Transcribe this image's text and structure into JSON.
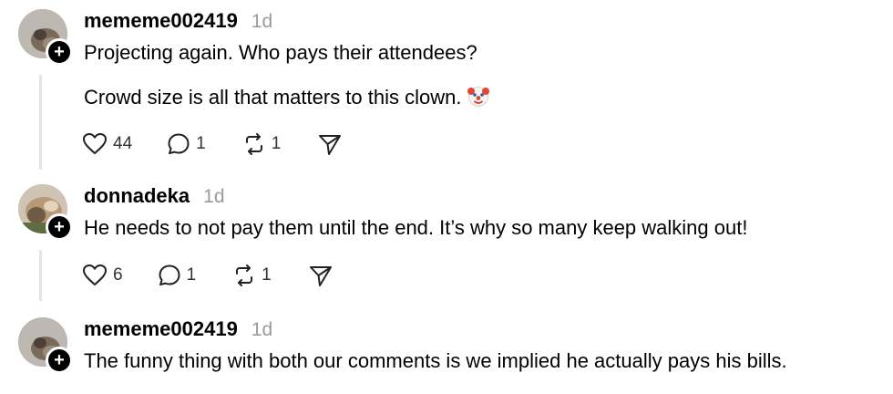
{
  "comments": [
    {
      "username": "mememe002419",
      "time": "1d",
      "lines": [
        "Projecting again. Who pays their attendees?",
        "Crowd size is all that matters to this clown."
      ],
      "emoji": "clown-face",
      "likes": "44",
      "replies": "1",
      "reposts": "1"
    },
    {
      "username": "donnadeka",
      "time": "1d",
      "lines": [
        "He needs to not pay them until the end. It’s why so many keep walking out!"
      ],
      "likes": "6",
      "replies": "1",
      "reposts": "1"
    },
    {
      "username": "mememe002419",
      "time": "1d",
      "lines": [
        "The funny thing with both our comments is we implied he actually pays his bills."
      ]
    }
  ],
  "icons": {
    "like": "heart-icon",
    "reply": "comment-bubble-icon",
    "repost": "repost-icon",
    "share": "send-icon",
    "follow": "plus-icon"
  },
  "colors": {
    "text": "#000000",
    "timestamp": "#9a9a9a",
    "thread_line": "#e4e4e4",
    "icon": "#333333"
  }
}
